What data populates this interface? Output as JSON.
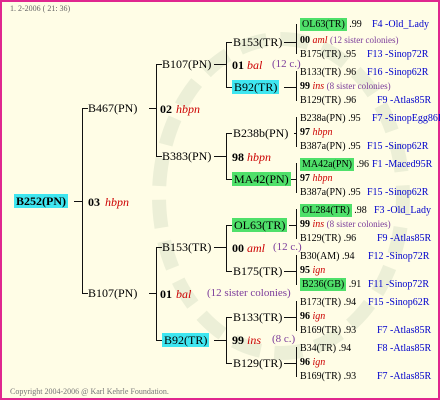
{
  "header": {
    "text": "1.  2-2006 ( 21: 36)"
  },
  "footer": {
    "copyright": "Copyright 2004-2006 @ Karl Kehrle Foundation."
  },
  "colors": {
    "frame": "#e0278f",
    "background": "#fffde6",
    "green_box": "#4fe06a",
    "cyan_box": "#3fe6f0",
    "link": "#0000cc",
    "year_italic": "#cc0000",
    "note": "#7a3a9a"
  },
  "root": {
    "name": "B252(PN)"
  },
  "gen1": [
    {
      "name": "B467(PN)",
      "year": "02",
      "breeder": "hbpn"
    },
    {
      "name": "B107(PN)",
      "year": "01",
      "breeder": "bal",
      "note": "(12 sister colonies)"
    }
  ],
  "root_meta": {
    "year": "03",
    "breeder": "hbpn"
  },
  "gen2": [
    {
      "name": "B107(PN)",
      "year": "01",
      "breeder": "bal",
      "note": "(12 c.)"
    },
    {
      "name": "B383(PN)",
      "year": "98",
      "breeder": "hbpn"
    },
    {
      "name": "B153(TR)",
      "year": "00",
      "breeder": "aml",
      "note": "(12 c.)"
    },
    {
      "name": "B92(TR)",
      "year": "99",
      "breeder": "ins",
      "note": "(8 c.)"
    }
  ],
  "gen3": [
    {
      "name": "B153(TR)"
    },
    {
      "name": "B92(TR)"
    },
    {
      "name": "B238b(PN)"
    },
    {
      "name": "MA42(PN)"
    },
    {
      "name": "OL63(TR)"
    },
    {
      "name": "B175(TR)"
    },
    {
      "name": "B133(TR)"
    },
    {
      "name": "B129(TR)"
    }
  ],
  "gen4": [
    {
      "name": "OL63(TR)",
      "val": ".99",
      "code": "F4 -Old_Lady"
    },
    {
      "year": "00",
      "breeder": "aml",
      "note": "(12 sister colonies)"
    },
    {
      "name": "B175(TR)",
      "val": ".95",
      "code": "F13 -Sinop72R"
    },
    {
      "name": "B133(TR)",
      "val": ".96",
      "code": "F16 -Sinop62R"
    },
    {
      "year": "99",
      "breeder": "ins",
      "note": "(8 sister colonies)"
    },
    {
      "name": "B129(TR)",
      "val": ".96",
      "code": "F9 -Atlas85R"
    },
    {
      "name": "B238a(PN)",
      "val": ".95",
      "code": "F7 -SinopEgg86R"
    },
    {
      "year": "97",
      "breeder": "hbpn"
    },
    {
      "name": "B387a(PN)",
      "val": ".95",
      "code": "F15 -Sinop62R"
    },
    {
      "name": "MA42a(PN)",
      "val": ".96",
      "code": "F1 -Maced95R"
    },
    {
      "year": "97",
      "breeder": "hbpn"
    },
    {
      "name": "B387a(PN)",
      "val": ".95",
      "code": "F15 -Sinop62R"
    },
    {
      "name": "OL284(TR)",
      "val": ".98",
      "code": "F3 -Old_Lady"
    },
    {
      "year": "99",
      "breeder": "ins",
      "note": "(8 sister colonies)"
    },
    {
      "name": "B129(TR)",
      "val": ".96",
      "code": "F9 -Atlas85R"
    },
    {
      "name": "B30(AM)",
      "val": ".94",
      "code": "F12 -Sinop72R"
    },
    {
      "year": "95",
      "breeder": "ign"
    },
    {
      "name": "B236(GB)",
      "val": ".91",
      "code": "F11 -Sinop72R"
    },
    {
      "name": "B173(TR)",
      "val": ".94",
      "code": "F15 -Sinop62R"
    },
    {
      "year": "96",
      "breeder": "ign"
    },
    {
      "name": "B169(TR)",
      "val": ".93",
      "code": "F7 -Atlas85R"
    },
    {
      "name": "B34(TR)",
      "val": ".94",
      "code": "F8 -Atlas85R"
    },
    {
      "year": "96",
      "breeder": "ign"
    },
    {
      "name": "B169(TR)",
      "val": ".93",
      "code": "F7 -Atlas85R"
    }
  ]
}
